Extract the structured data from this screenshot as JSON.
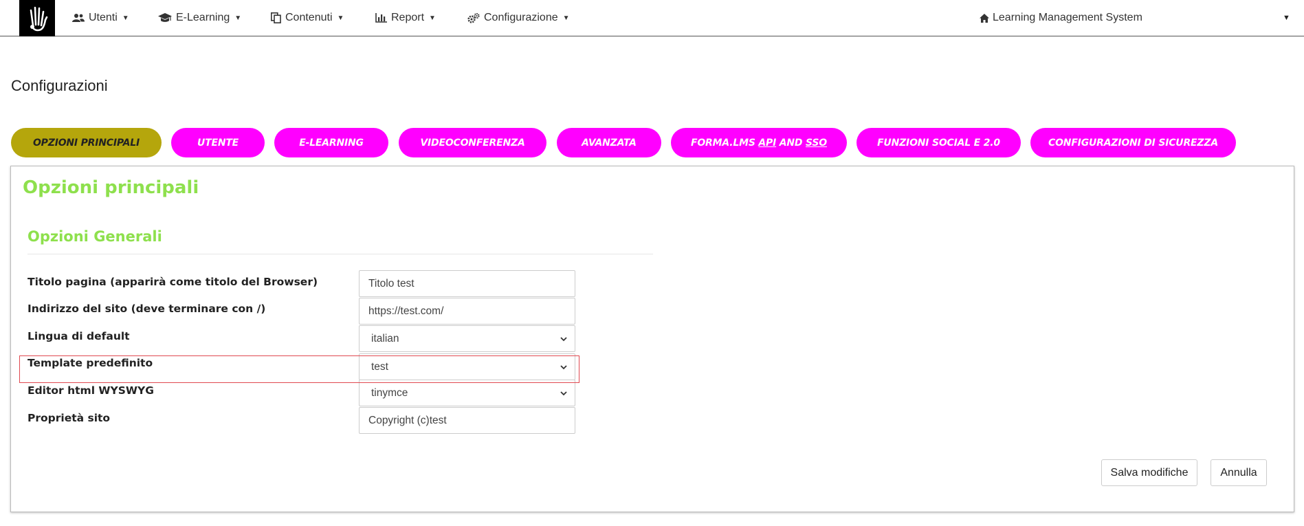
{
  "header": {
    "logo_icon": "hand-logo-icon",
    "nav": [
      {
        "label": "Utenti",
        "icon": "users-icon"
      },
      {
        "label": "E-Learning",
        "icon": "graduation-cap-icon"
      },
      {
        "label": "Contenuti",
        "icon": "files-icon"
      },
      {
        "label": "Report",
        "icon": "bar-chart-icon"
      },
      {
        "label": "Configurazione",
        "icon": "cogs-icon"
      }
    ],
    "site_title": "Learning Management System",
    "site_icon": "home-icon"
  },
  "page": {
    "title": "Configurazioni"
  },
  "tabs": [
    {
      "label": "OPZIONI PRINCIPALI",
      "active": true
    },
    {
      "label": "UTENTE"
    },
    {
      "label": "E-LEARNING"
    },
    {
      "label": "VIDEOCONFERENZA"
    },
    {
      "label": "AVANZATA"
    },
    {
      "label_prefix": "FORMA.LMS ",
      "label_u1": "API",
      "label_mid": " AND ",
      "label_u2": "SSO"
    },
    {
      "label": "FUNZIONI SOCIAL E 2.0"
    },
    {
      "label": "CONFIGURAZIONI DI SICUREZZA"
    }
  ],
  "panel": {
    "title": "Opzioni principali",
    "section_title": "Opzioni Generali",
    "fields": [
      {
        "label": "Titolo pagina (apparirà come titolo del Browser)",
        "value": "Titolo test",
        "type": "text"
      },
      {
        "label": "Indirizzo del sito (deve terminare con /)",
        "value": "https://test.com/",
        "type": "text"
      },
      {
        "label": "Lingua di default",
        "value": "italian",
        "type": "select"
      },
      {
        "label": "Template predefinito",
        "value": "test",
        "type": "select"
      },
      {
        "label": "Editor html WYSWYG",
        "value": "tinymce",
        "type": "select"
      },
      {
        "label": "Proprietà sito",
        "value": "Copyright (c)test",
        "type": "text"
      }
    ],
    "save_label": "Salva modifiche",
    "cancel_label": "Annulla"
  },
  "colors": {
    "tab_bg": "#ff00ff",
    "tab_active_bg": "#b5a60c",
    "heading_green": "#8ee04d",
    "highlight_red": "#e0484f"
  }
}
